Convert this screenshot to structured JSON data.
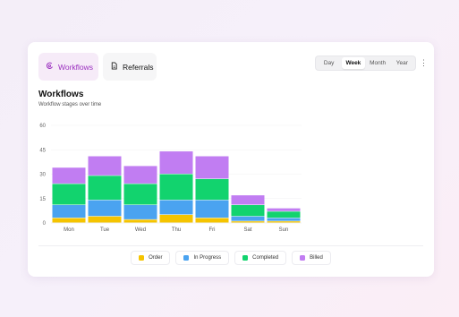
{
  "tabs": [
    {
      "label": "Workflows",
      "icon": "workflow-icon",
      "active": true
    },
    {
      "label": "Referrals",
      "icon": "document-icon",
      "active": false
    }
  ],
  "range": {
    "options": [
      "Day",
      "Week",
      "Month",
      "Year"
    ],
    "selected": "Week"
  },
  "more_icon": "more-vertical-icon",
  "header": {
    "title": "Workflows",
    "subtitle": "Workflow stages over time"
  },
  "colors": {
    "accent": "#9a2fbf",
    "Order": "#f5c400",
    "In Progress": "#4aa3f0",
    "Completed": "#12d36e",
    "Billed": "#c17df2"
  },
  "chart_data": {
    "type": "bar",
    "stacked": true,
    "categories": [
      "Mon",
      "Tue",
      "Wed",
      "Thu",
      "Fri",
      "Sat",
      "Sun"
    ],
    "series": [
      {
        "name": "Order",
        "values": [
          3,
          4,
          2,
          5,
          3,
          1,
          1
        ]
      },
      {
        "name": "In Progress",
        "values": [
          8,
          10,
          9,
          9,
          11,
          3,
          2
        ]
      },
      {
        "name": "Completed",
        "values": [
          13,
          15,
          13,
          16,
          13,
          7,
          4
        ]
      },
      {
        "name": "Billed",
        "values": [
          10,
          12,
          11,
          14,
          14,
          6,
          2
        ]
      }
    ],
    "yticks": [
      0,
      15,
      30,
      45,
      60
    ],
    "ylim": [
      0,
      60
    ],
    "grid": true,
    "legend": "bottom-center"
  }
}
